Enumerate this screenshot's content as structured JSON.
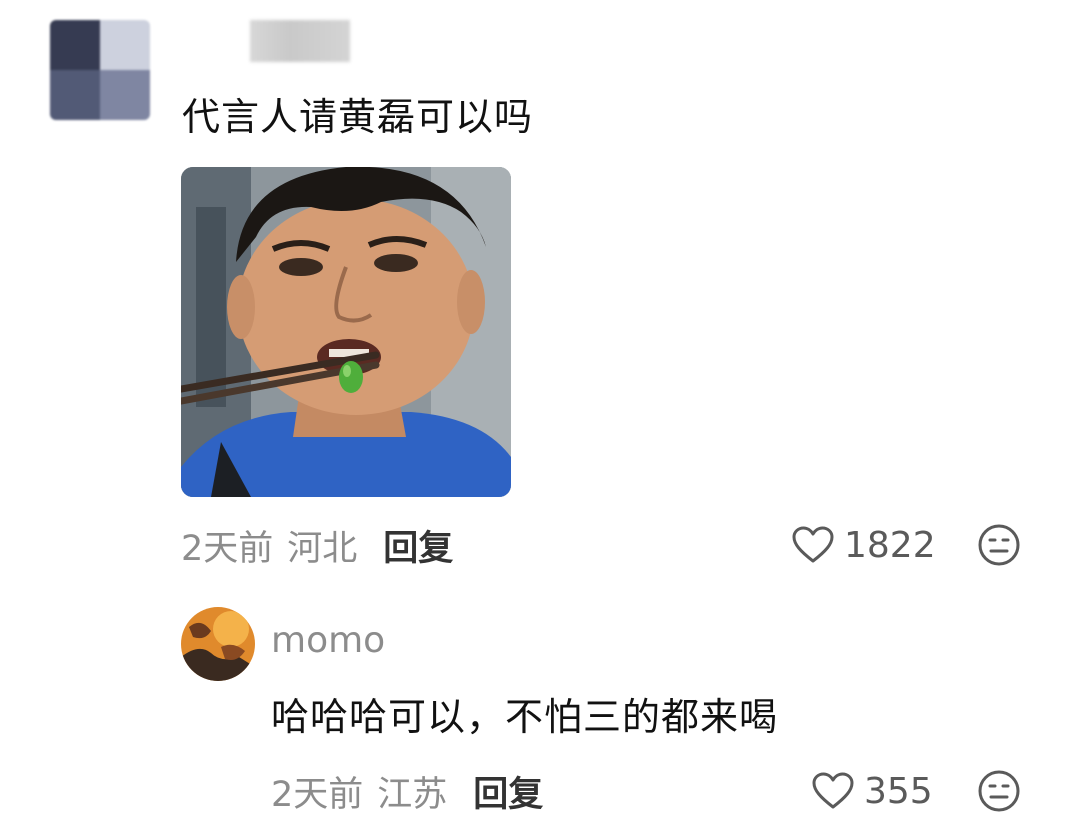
{
  "comment": {
    "avatar_icon": "blurred-avatar",
    "username_blurred": true,
    "text": "代言人请黄磊可以吗",
    "sticker_icon": "man-eating-green-bean-with-chopsticks",
    "time": "2天前",
    "location": "河北",
    "reply_label": "回复",
    "likes": "1822",
    "like_icon": "heart-outline-icon",
    "dislike_icon": "meh-face-icon"
  },
  "reply": {
    "avatar_icon": "orange-avatar",
    "username": "momo",
    "text": "哈哈哈可以，不怕三的都来喝",
    "time": "2天前",
    "location": "江苏",
    "reply_label": "回复",
    "likes": "355",
    "like_icon": "heart-outline-icon",
    "dislike_icon": "meh-face-icon"
  },
  "colors": {
    "meta_text": "#8c8c8c",
    "reply_label": "#333333",
    "icon_stroke": "#5a5a5a"
  }
}
